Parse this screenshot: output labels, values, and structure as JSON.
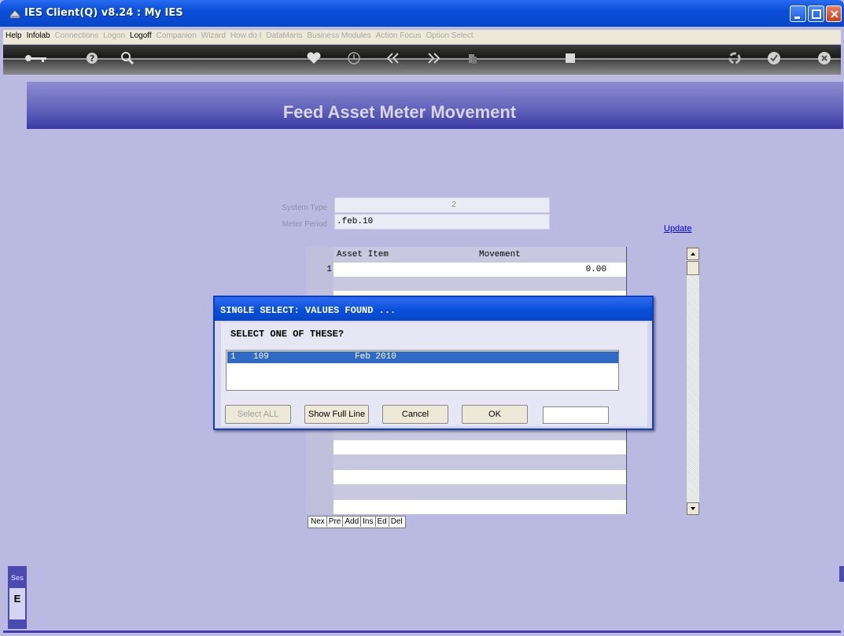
{
  "window": {
    "title": "IES Client(Q) v8.24 : My IES",
    "controls": [
      "minimize",
      "maximize",
      "close"
    ]
  },
  "menu": [
    {
      "label": "Help",
      "enabled": true
    },
    {
      "label": "Infolab",
      "enabled": true
    },
    {
      "label": "Connections",
      "enabled": false
    },
    {
      "label": "Logon",
      "enabled": false
    },
    {
      "label": "Logoff",
      "enabled": true
    },
    {
      "label": "Companion",
      "enabled": false
    },
    {
      "label": "Wizard",
      "enabled": false
    },
    {
      "label": "How do I",
      "enabled": false
    },
    {
      "label": "DataMarts",
      "enabled": false
    },
    {
      "label": "Business Modules",
      "enabled": false
    },
    {
      "label": "Action Focus",
      "enabled": false
    },
    {
      "label": "Option Select",
      "enabled": false
    }
  ],
  "toolbar_icons": [
    "key-icon",
    "help-icon",
    "search-icon",
    "heart-icon",
    "clock-icon",
    "back-icon",
    "forward-icon",
    "copy-icon",
    "stop-icon",
    "recycle-icon",
    "check-icon",
    "close-icon"
  ],
  "page": {
    "heading": "Feed Asset Meter Movement",
    "system_type_label": "System Type",
    "system_type_value": "2",
    "meter_period_label": "Meter Period",
    "meter_period_value": ".feb.10",
    "update_link": "Update"
  },
  "grid": {
    "columns": [
      "Asset Item",
      "Movement"
    ],
    "rows": [
      {
        "num": "1",
        "asset_item": "",
        "movement": "0.00"
      }
    ],
    "nav": [
      "Nex",
      "Pre",
      "Add",
      "Ins",
      "Ed",
      "Del"
    ]
  },
  "dialog": {
    "title": "SINGLE SELECT: VALUES FOUND ...",
    "prompt": "SELECT ONE OF THESE?",
    "items": [
      {
        "index": "1",
        "code": "109",
        "desc": "Feb 2010"
      }
    ],
    "buttons": {
      "select_all": "Select ALL",
      "show_full_line": "Show Full Line",
      "cancel": "Cancel",
      "ok": "OK"
    }
  },
  "side_tab": {
    "label_top": "Ses",
    "label_box": "E"
  }
}
